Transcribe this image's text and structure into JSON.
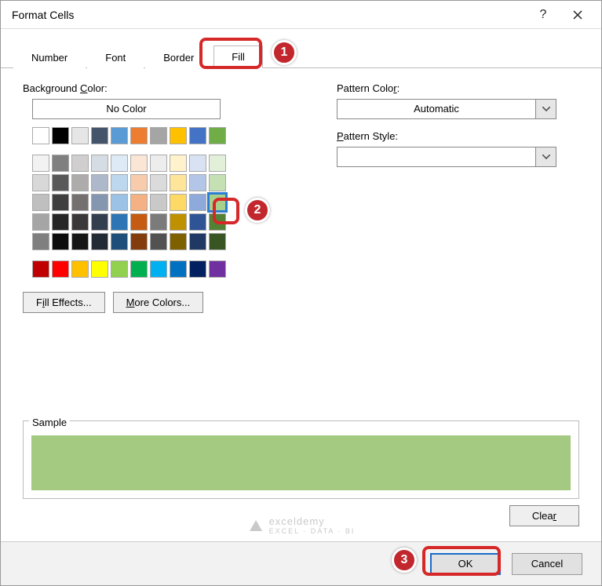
{
  "title": "Format Cells",
  "tabs": [
    "Number",
    "Font",
    "Border",
    "Fill"
  ],
  "activeTab": "Fill",
  "bgLabel": "Background Color:",
  "noColor": "No Color",
  "fillEffects": "Fill Effects...",
  "moreColors": "More Colors...",
  "patternColorLabel": "Pattern Color:",
  "patternColorValue": "Automatic",
  "patternStyleLabel": "Pattern Style:",
  "patternStyleValue": "",
  "sampleLabel": "Sample",
  "sampleColor": "#a4c981",
  "clear": "Clear",
  "ok": "OK",
  "cancel": "Cancel",
  "wm": "exceldemy",
  "wmsub": "EXCEL · DATA · BI",
  "palette": {
    "row1": [
      "#ffffff",
      "#000000",
      "#e7e6e6",
      "#44546a",
      "#5b9bd5",
      "#ed7d31",
      "#a5a5a5",
      "#ffc000",
      "#4472c4",
      "#70ad47"
    ],
    "theme": [
      [
        "#f2f2f2",
        "#808080",
        "#d0cece",
        "#d6dce4",
        "#deebf6",
        "#fbe5d5",
        "#ededed",
        "#fff2cc",
        "#d9e2f3",
        "#e2efd9"
      ],
      [
        "#d8d8d8",
        "#595959",
        "#aeabab",
        "#adb9ca",
        "#bdd7ee",
        "#f7cbac",
        "#dbdbdb",
        "#fee599",
        "#b4c6e7",
        "#c5e0b3"
      ],
      [
        "#bfbfbf",
        "#3f3f3f",
        "#757070",
        "#8496b0",
        "#9cc3e5",
        "#f4b183",
        "#c9c9c9",
        "#ffd965",
        "#8eaadb",
        "#a8d08d"
      ],
      [
        "#a5a5a5",
        "#262626",
        "#3a3838",
        "#333f4f",
        "#2e75b5",
        "#c55a11",
        "#7b7b7b",
        "#bf9000",
        "#2f5496",
        "#538135"
      ],
      [
        "#7f7f7f",
        "#0c0c0c",
        "#171616",
        "#222a35",
        "#1e4e79",
        "#833c0b",
        "#525252",
        "#7f6000",
        "#1f3864",
        "#375623"
      ]
    ],
    "standard": [
      "#c00000",
      "#ff0000",
      "#ffc000",
      "#ffff00",
      "#92d050",
      "#00b050",
      "#00b0f0",
      "#0070c0",
      "#002060",
      "#7030a0"
    ]
  },
  "selectedSwatch": "2,9",
  "badges": {
    "b1": "1",
    "b2": "2",
    "b3": "3"
  }
}
